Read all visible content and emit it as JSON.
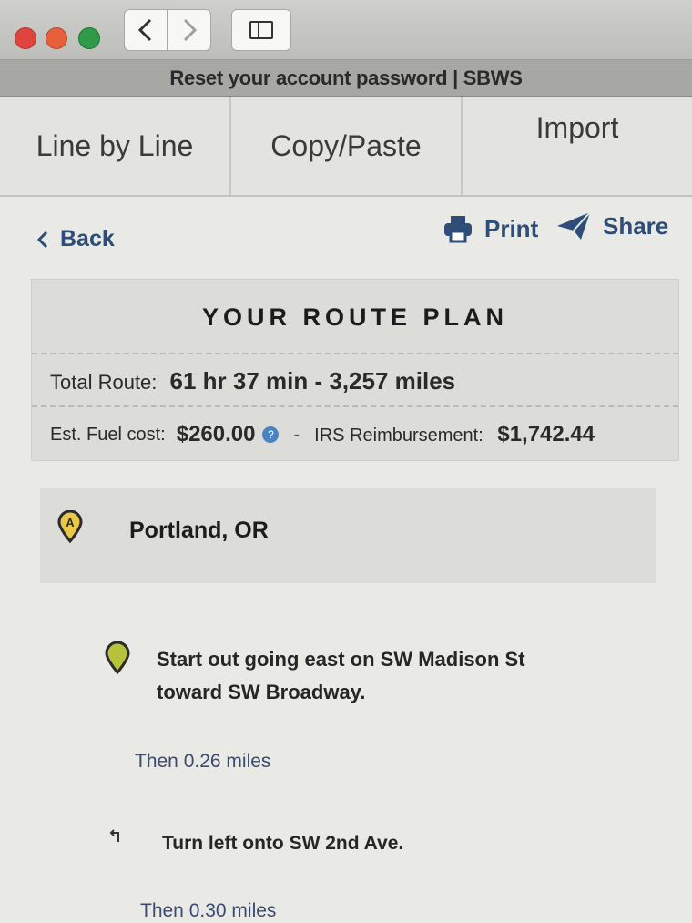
{
  "window": {
    "tab_title": "Reset your account password | SBWS"
  },
  "segnav": {
    "items": [
      "Line by Line",
      "Copy/Paste",
      "Import"
    ]
  },
  "actions": {
    "back": "Back",
    "print": "Print",
    "share": "Share"
  },
  "summary": {
    "title": "YOUR ROUTE PLAN",
    "total_label": "Total Route:",
    "total_value": "61 hr 37 min - 3,257 miles",
    "fuel_label": "Est. Fuel cost:",
    "fuel_value": "$260.00",
    "separator": "-",
    "irs_label": "IRS Reimbursement:",
    "irs_value": "$1,742.44"
  },
  "start": {
    "marker_letter": "A",
    "name": "Portland, OR"
  },
  "steps": [
    {
      "text": "Start out going east on SW Madison St toward SW Broadway.",
      "then": "Then 0.26 miles"
    },
    {
      "text": "Turn left onto SW 2nd Ave.",
      "then": "Then 0.30 miles"
    }
  ],
  "colors": {
    "link": "#2e4d78",
    "start_pin": "#e8c94a",
    "step_pin": "#b6c23a"
  },
  "icons": {
    "back": "chevron-left-icon",
    "print": "printer-icon",
    "share": "paper-plane-icon",
    "turn": "turn-left-icon"
  }
}
